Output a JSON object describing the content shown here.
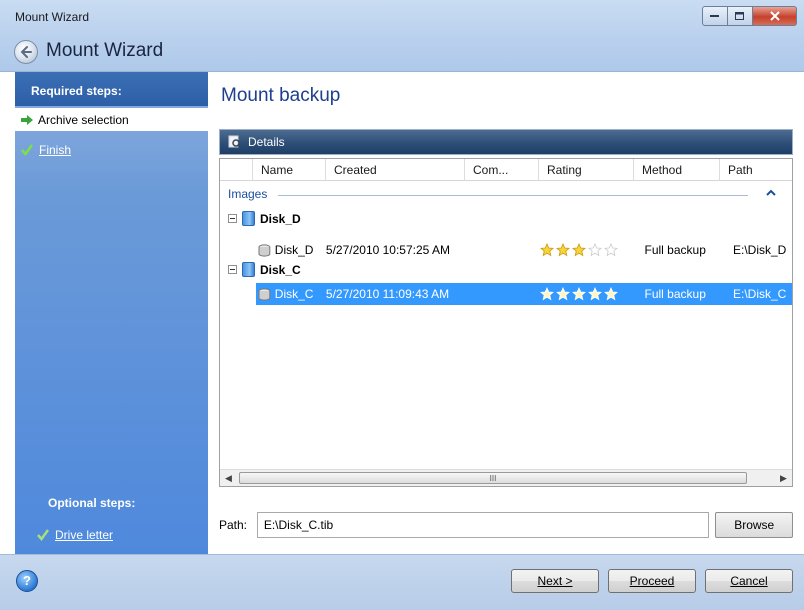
{
  "window": {
    "title": "Mount Wizard",
    "app_title": "Mount Wizard"
  },
  "sidebar": {
    "required_heading": "Required steps:",
    "steps": [
      {
        "label": "Archive selection",
        "state": "current"
      },
      {
        "label": "Finish",
        "state": "pending"
      }
    ],
    "optional_heading": "Optional steps:",
    "optional_steps": [
      {
        "label": "Drive letter"
      }
    ]
  },
  "main": {
    "title": "Mount backup",
    "details_label": "Details",
    "columns": [
      "Name",
      "Created",
      "Com...",
      "Rating",
      "Method",
      "Path"
    ],
    "group_label": "Images",
    "disks": [
      {
        "name": "Disk_D",
        "backups": [
          {
            "name": "Disk_D",
            "created": "5/27/2010 10:57:25 AM",
            "rating": 3,
            "method": "Full backup",
            "path": "E:\\Disk_D",
            "selected": false
          }
        ]
      },
      {
        "name": "Disk_C",
        "backups": [
          {
            "name": "Disk_C",
            "created": "5/27/2010 11:09:43 AM",
            "rating": 5,
            "method": "Full backup",
            "path": "E:\\Disk_C",
            "selected": true
          }
        ]
      }
    ],
    "scroll_thumb_glyph": "III",
    "path_label": "Path:",
    "path_value": "E:\\Disk_C.tib",
    "browse_label": "Browse"
  },
  "footer": {
    "help_label": "?",
    "next_label": "Next >",
    "proceed_label": "Proceed",
    "cancel_label": "Cancel"
  },
  "colors": {
    "selection": "#3399ff",
    "sidebar": "#4f89dc",
    "title_accent": "#1d3f8e"
  }
}
